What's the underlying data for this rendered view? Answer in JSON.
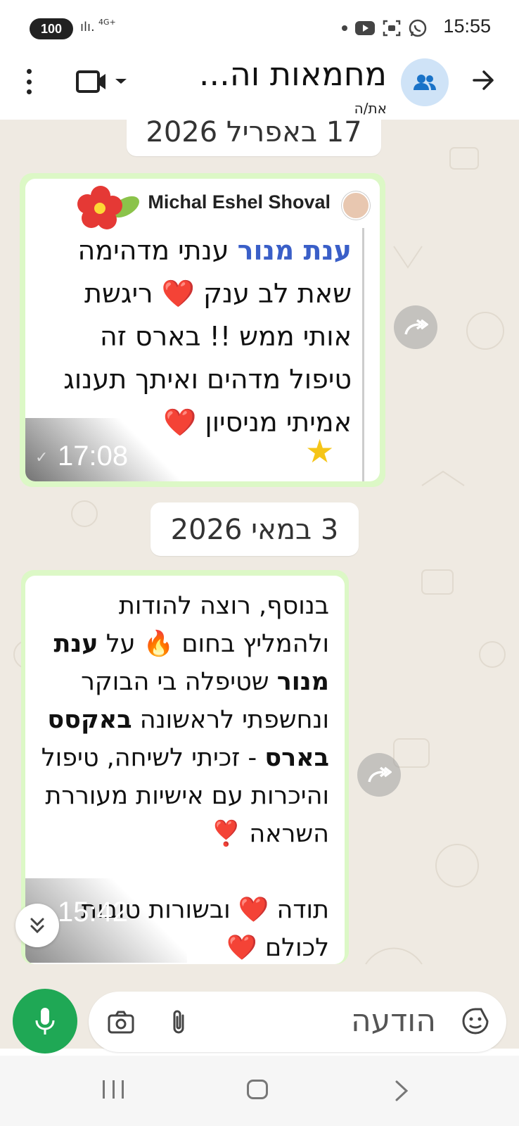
{
  "status_bar": {
    "battery": "100",
    "network": "4G+",
    "time": "15:55"
  },
  "header": {
    "title": "מחמאות וה...",
    "subtitle": "את/ה"
  },
  "chat": {
    "date_1": "17 באפריל 2026",
    "message_1": {
      "sender": "Michal Eshel Shoval",
      "highlight": "ענת מנור",
      "text_rest": " ענתי מדהימה שאת לב ענק ❤️ ריגשת אותי ממש !!  בארס זה טיפול מדהים ואיתך תענוג אמיתי מניסיון ❤️",
      "time": "17:08"
    },
    "date_2": "3 במאי 2026",
    "message_2": {
      "p1": "בנוסף, רוצה להודות ולהמליץ בחום 🔥 על ",
      "bold1": "ענת מנור",
      "p2": " שטיפלה בי הבוקר ונחשפתי לראשונה ",
      "bold2": "באקסס בארס",
      "p3": " - זכיתי לשיחה, טיפול והיכרות עם אישיות מעוררת השראה ❣️",
      "p4": "תודה ❤️ ובשורות טובות לכולם ❤️",
      "time": "15:42"
    }
  },
  "input": {
    "placeholder": "הודעה"
  }
}
